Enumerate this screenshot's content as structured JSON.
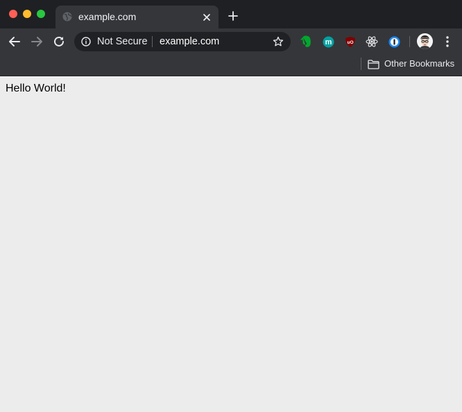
{
  "browser": {
    "tab": {
      "title": "example.com",
      "favicon": "globe-icon"
    },
    "toolbar": {
      "security_label": "Not Secure",
      "url": "example.com"
    },
    "extensions": [
      "evernote-icon",
      "m-extension-icon",
      "ublock-origin-icon",
      "react-devtools-icon",
      "1password-icon"
    ],
    "bookmarks_bar": {
      "other_bookmarks_label": "Other Bookmarks"
    },
    "colors": {
      "frame": "#1f2023",
      "toolbar": "#35363a",
      "omnibox": "#202124",
      "page_background": "#ececec"
    }
  },
  "page": {
    "body_text": "Hello World!"
  }
}
